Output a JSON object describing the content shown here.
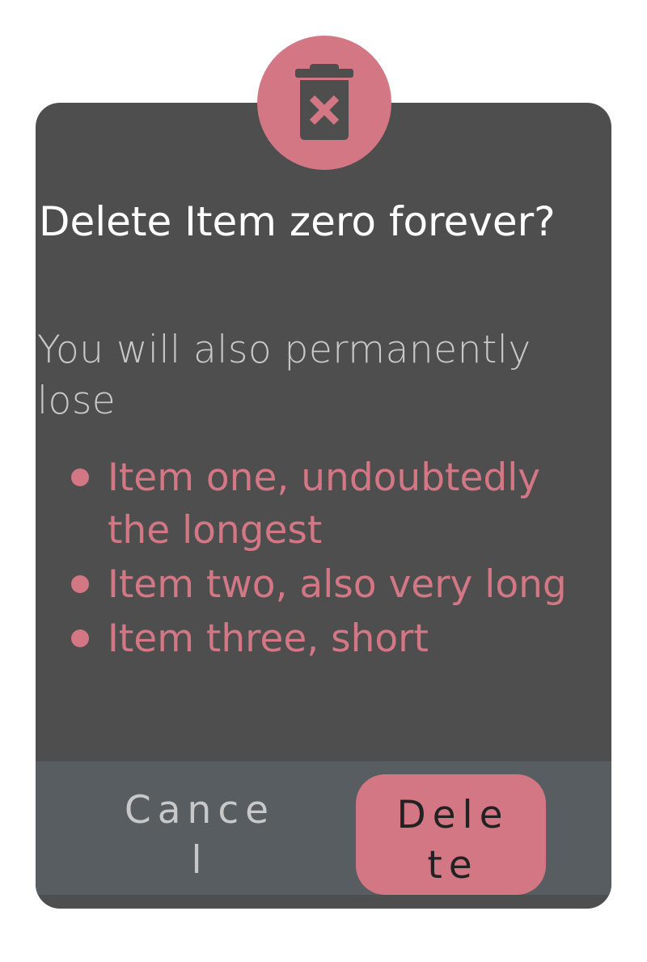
{
  "dialog": {
    "icon": "trash-x-icon",
    "title": "Delete Item zero forever?",
    "lead": "You will also permanently lose",
    "items": [
      "Item one, undoubtedly the longest",
      "Item two, also very long",
      "Item three, short"
    ],
    "cancel_label": "Cancel",
    "delete_label": "Delete"
  },
  "colors": {
    "accent": "#d47784",
    "panel": "#4e4e4e",
    "footer": "#575d60",
    "title_text": "#ffffff",
    "muted_text": "#c8c8c8"
  }
}
